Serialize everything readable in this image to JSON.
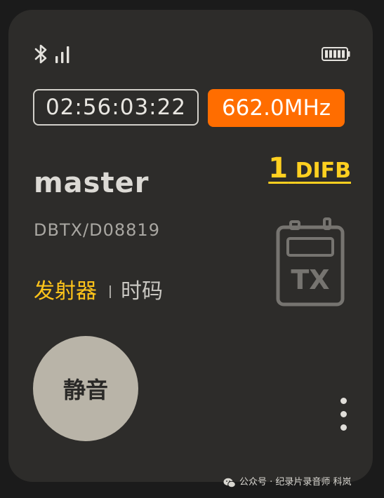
{
  "status": {
    "bluetooth_icon": "bluetooth-icon",
    "signal_icon": "signal-bars-icon",
    "battery_icon": "battery-full-icon"
  },
  "timecode": "02:56:03:22",
  "frequency": "662.0MHz",
  "channel": {
    "number": "1",
    "name": "DIFB"
  },
  "device": {
    "name": "master",
    "id": "DBTX/D08819",
    "type_icon_label": "TX"
  },
  "tabs": [
    {
      "label": "发射器",
      "active": true
    },
    {
      "label": "时码",
      "active": false
    }
  ],
  "mute_button_label": "静音",
  "more_icon": "more-vertical-icon",
  "watermark": "公众号 · 纪录片录音师 科岚",
  "colors": {
    "card_background": "#2d2c2a",
    "frequency_badge": "#ff6d00",
    "accent_yellow": "#ffc41a",
    "mute_button": "#b9b4a8"
  }
}
